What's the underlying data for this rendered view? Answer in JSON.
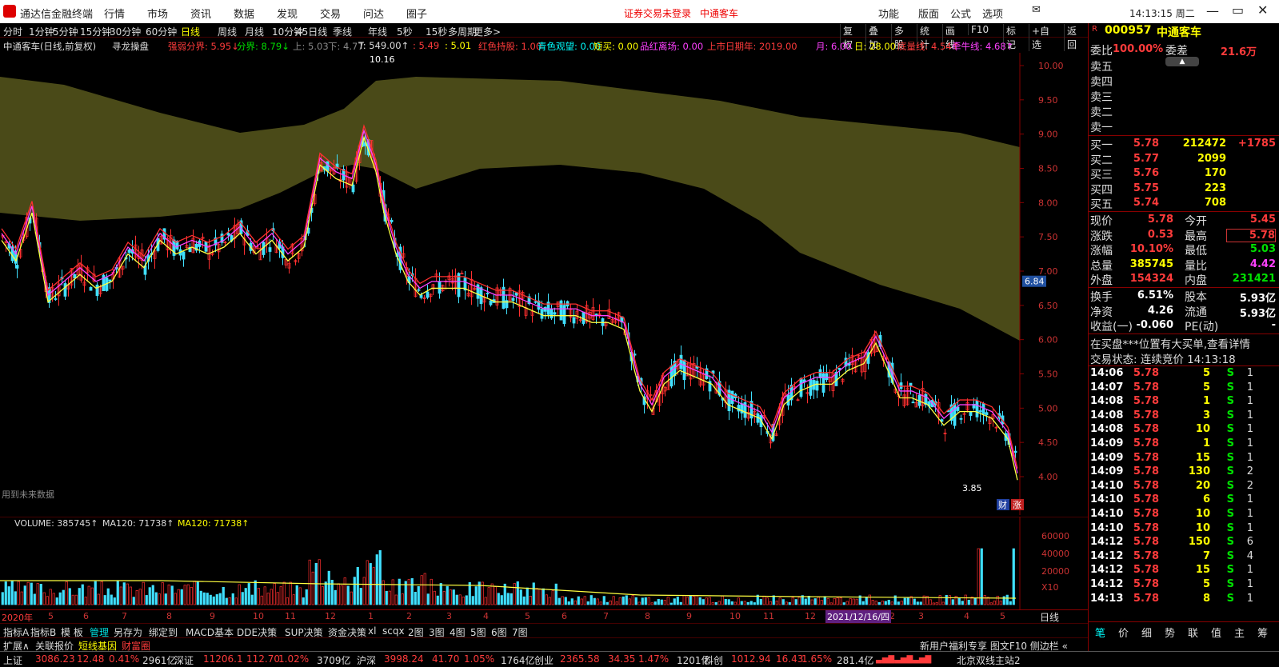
{
  "app": {
    "title": "通达信金融终端",
    "menu": [
      "行情",
      "市场",
      "资讯",
      "数据",
      "发现",
      "交易",
      "问达",
      "圈子"
    ],
    "notice": "证券交易未登录",
    "notice_name": "中通客车",
    "sysmenu": [
      "功能",
      "版面",
      "公式",
      "选项"
    ],
    "clock": "14:13:15 周二"
  },
  "periods": [
    "分时",
    "1分钟",
    "5分钟",
    "15分钟",
    "30分钟",
    "60分钟",
    "日线",
    "周线",
    "月线",
    "10分钟",
    "45日线",
    "季线",
    "年线",
    "5秒",
    "15秒",
    "多周期",
    "更多>"
  ],
  "toolbar_right": [
    "复权",
    "叠加",
    "多股",
    "统计",
    "画线",
    "F10",
    "标记",
    "+自选",
    "返回"
  ],
  "info": {
    "name": "中通客车(日线,前复权)",
    "indicator": "寻龙操盘",
    "items": [
      {
        "t": "强弱分界: 5.95↓",
        "c": "#ff3b3b"
      },
      {
        "t": "分界: 8.79↓",
        "c": "#00e000"
      },
      {
        "t": "上: 5.03",
        "c": "#888"
      },
      {
        "t": "下: 4.77",
        "c": "#888"
      },
      {
        "t": "T: 549.00↑",
        "c": "#ddd"
      },
      {
        "t": ": 5.49",
        "c": "#ff3b3b"
      },
      {
        "t": ": 5.01",
        "c": "#ffff00"
      },
      {
        "t": "红色持股: 1.00",
        "c": "#ff3b3b"
      },
      {
        "t": "青色观望: 0.00",
        "c": "#00ffff"
      },
      {
        "t": "短买: 0.00",
        "c": "#ffff00"
      },
      {
        "t": "品红离场: 0.00",
        "c": "#ff40ff"
      },
      {
        "t": "上市日期年: 2019.00",
        "c": "#ff3b3b"
      },
      {
        "t": "月: 6.00",
        "c": "#ff40ff"
      },
      {
        "t": "日: 28.00",
        "c": "#ffff00"
      },
      {
        "t": "底量线: 4.54↑",
        "c": "#ff3b3b"
      },
      {
        "t": "牵牛线: 4.68↑",
        "c": "#ff40ff"
      }
    ]
  },
  "chart": {
    "high_label": "10.16",
    "low_label": "3.85",
    "price_axis": [
      "10.00",
      "9.50",
      "9.00",
      "8.50",
      "8.00",
      "7.50",
      "7.00",
      "6.50",
      "6.00",
      "5.50",
      "5.00",
      "4.50",
      "4.00"
    ],
    "cursor_price": "6.84",
    "future_note": "用到未来数据",
    "badges": [
      "财",
      "涨"
    ]
  },
  "volume": {
    "label": "VOLUME: 385745↑",
    "ma1": "MA120: 71738↑",
    "ma2": "MA120: 71738↑",
    "axis": [
      "60000",
      "40000",
      "20000",
      "X10"
    ]
  },
  "dates": [
    "2020年",
    "5",
    "6",
    "7",
    "8",
    "9",
    "10",
    "11",
    "12",
    "1",
    "2",
    "3",
    "4",
    "5",
    "6",
    "7",
    "8",
    "9",
    "10",
    "11",
    "12",
    "2",
    "3",
    "4",
    "5"
  ],
  "date_highlight": "2021/12/16/四",
  "bottom_tabs": [
    "指标A",
    "指标B",
    "模 板",
    "管理",
    "另存为",
    "绑定到",
    "MACD基本",
    "DDE决策",
    "SUP决策",
    "资金决策",
    "xl",
    "scqx",
    "2图",
    "3图",
    "4图",
    "5图",
    "6图",
    "7图"
  ],
  "row2": [
    {
      "t": "扩展∧",
      "c": "#ddd"
    },
    {
      "t": "关联报价",
      "c": "#ddd"
    },
    {
      "t": "短线基因",
      "c": "#ffff00"
    },
    {
      "t": "财富圈",
      "c": "#ff3b3b"
    }
  ],
  "row2_right": "新用户福利专享 图文F10 侧边栏 «",
  "status": {
    "items": [
      {
        "t": "上证",
        "c": "#ddd"
      },
      {
        "t": "3086.23",
        "c": "#ff3b3b"
      },
      {
        "t": "12.48",
        "c": "#ff3b3b"
      },
      {
        "t": "0.41%",
        "c": "#ff3b3b"
      },
      {
        "t": "2961亿",
        "c": "#ddd"
      },
      {
        "t": "深证",
        "c": "#ddd"
      },
      {
        "t": "11206.1",
        "c": "#ff3b3b"
      },
      {
        "t": "112.70",
        "c": "#ff3b3b"
      },
      {
        "t": "1.02%",
        "c": "#ff3b3b"
      },
      {
        "t": "3709亿",
        "c": "#ddd"
      },
      {
        "t": "沪深",
        "c": "#ddd"
      },
      {
        "t": "3998.24",
        "c": "#ff3b3b"
      },
      {
        "t": "41.70",
        "c": "#ff3b3b"
      },
      {
        "t": "1.05%",
        "c": "#ff3b3b"
      },
      {
        "t": "1764亿",
        "c": "#ddd"
      },
      {
        "t": "创业",
        "c": "#ddd"
      },
      {
        "t": "2365.58",
        "c": "#ff3b3b"
      },
      {
        "t": "34.35",
        "c": "#ff3b3b"
      },
      {
        "t": "1.47%",
        "c": "#ff3b3b"
      },
      {
        "t": "1201亿",
        "c": "#ddd"
      },
      {
        "t": "科创",
        "c": "#ddd"
      },
      {
        "t": "1012.94",
        "c": "#ff3b3b"
      },
      {
        "t": "16.43",
        "c": "#ff3b3b"
      },
      {
        "t": "1.65%",
        "c": "#ff3b3b"
      },
      {
        "t": "281.4亿",
        "c": "#ddd"
      }
    ],
    "server": "北京双线主站2"
  },
  "quote": {
    "code": "000957",
    "name": "中通客车",
    "weibi_label": "委比",
    "weibi": "100.00%",
    "weicha_label": "委差",
    "weicha": "21.6万",
    "asks": [
      "卖五",
      "卖四",
      "卖三",
      "卖二",
      "卖一"
    ],
    "bids": [
      {
        "l": "买一",
        "p": "5.78",
        "v": "212472",
        "d": "+1785"
      },
      {
        "l": "买二",
        "p": "5.77",
        "v": "2099",
        "d": ""
      },
      {
        "l": "买三",
        "p": "5.76",
        "v": "170",
        "d": ""
      },
      {
        "l": "买四",
        "p": "5.75",
        "v": "223",
        "d": ""
      },
      {
        "l": "买五",
        "p": "5.74",
        "v": "708",
        "d": ""
      }
    ],
    "stats": [
      {
        "l": "现价",
        "v": "5.78",
        "c": "#ff3b3b",
        "l2": "今开",
        "v2": "5.45",
        "c2": "#ff3b3b"
      },
      {
        "l": "涨跌",
        "v": "0.53",
        "c": "#ff3b3b",
        "l2": "最高",
        "v2": "5.78",
        "c2": "#ff3b3b"
      },
      {
        "l": "涨幅",
        "v": "10.10%",
        "c": "#ff3b3b",
        "l2": "最低",
        "v2": "5.03",
        "c2": "#00e000"
      },
      {
        "l": "总量",
        "v": "385745",
        "c": "#ffff00",
        "l2": "量比",
        "v2": "4.42",
        "c2": "#ff40ff"
      },
      {
        "l": "外盘",
        "v": "154324",
        "c": "#ff3b3b",
        "l2": "内盘",
        "v2": "231421",
        "c2": "#00e000"
      }
    ],
    "stats2": [
      {
        "l": "换手",
        "v": "6.51%",
        "c": "#fff",
        "l2": "股本",
        "v2": "5.93亿",
        "c2": "#fff"
      },
      {
        "l": "净资",
        "v": "4.26",
        "c": "#fff",
        "l2": "流通",
        "v2": "5.93亿",
        "c2": "#fff"
      },
      {
        "l": "收益(一)",
        "v": "-0.060",
        "c": "#fff",
        "l2": "PE(动)",
        "v2": "-",
        "c2": "#fff"
      }
    ],
    "alert": "在买盘***位置有大买单,查看详情",
    "trade_state": "交易状态: 连续竞价 14:13:18",
    "ticks": [
      {
        "t": "14:06",
        "p": "5.78",
        "v": "5",
        "s": "S",
        "n": "1"
      },
      {
        "t": "14:07",
        "p": "5.78",
        "v": "5",
        "s": "S",
        "n": "1"
      },
      {
        "t": "14:08",
        "p": "5.78",
        "v": "1",
        "s": "S",
        "n": "1"
      },
      {
        "t": "14:08",
        "p": "5.78",
        "v": "3",
        "s": "S",
        "n": "1"
      },
      {
        "t": "14:08",
        "p": "5.78",
        "v": "10",
        "s": "S",
        "n": "1"
      },
      {
        "t": "14:09",
        "p": "5.78",
        "v": "1",
        "s": "S",
        "n": "1"
      },
      {
        "t": "14:09",
        "p": "5.78",
        "v": "15",
        "s": "S",
        "n": "1"
      },
      {
        "t": "14:09",
        "p": "5.78",
        "v": "130",
        "s": "S",
        "n": "2"
      },
      {
        "t": "14:10",
        "p": "5.78",
        "v": "20",
        "s": "S",
        "n": "2"
      },
      {
        "t": "14:10",
        "p": "5.78",
        "v": "6",
        "s": "S",
        "n": "1"
      },
      {
        "t": "14:10",
        "p": "5.78",
        "v": "10",
        "s": "S",
        "n": "1"
      },
      {
        "t": "14:10",
        "p": "5.78",
        "v": "10",
        "s": "S",
        "n": "1"
      },
      {
        "t": "14:12",
        "p": "5.78",
        "v": "150",
        "s": "S",
        "n": "6"
      },
      {
        "t": "14:12",
        "p": "5.78",
        "v": "7",
        "s": "S",
        "n": "4"
      },
      {
        "t": "14:12",
        "p": "5.78",
        "v": "15",
        "s": "S",
        "n": "1"
      },
      {
        "t": "14:12",
        "p": "5.78",
        "v": "5",
        "s": "S",
        "n": "1"
      },
      {
        "t": "14:13",
        "p": "5.78",
        "v": "8",
        "s": "S",
        "n": "1"
      }
    ],
    "tabs": [
      "笔",
      "价",
      "细",
      "势",
      "联",
      "值",
      "主",
      "筹"
    ]
  }
}
